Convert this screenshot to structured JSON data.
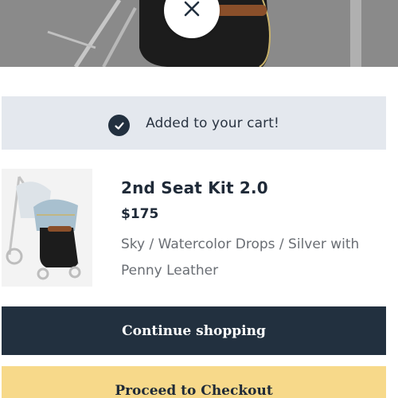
{
  "cart_notice": {
    "message": "Added to your cart!"
  },
  "product": {
    "name": "2nd Seat Kit 2.0",
    "price": "$175",
    "variant": "Sky / Watercolor Drops / Silver with Penny Leather"
  },
  "actions": {
    "continue_label": "Continue shopping",
    "checkout_label": "Proceed to Checkout"
  },
  "icons": {
    "close": "close-icon",
    "confirmation": "check-circle-icon"
  },
  "colors": {
    "navy": "#22303f",
    "banner": "#e4e8ee",
    "checkout": "#f7d98a"
  }
}
